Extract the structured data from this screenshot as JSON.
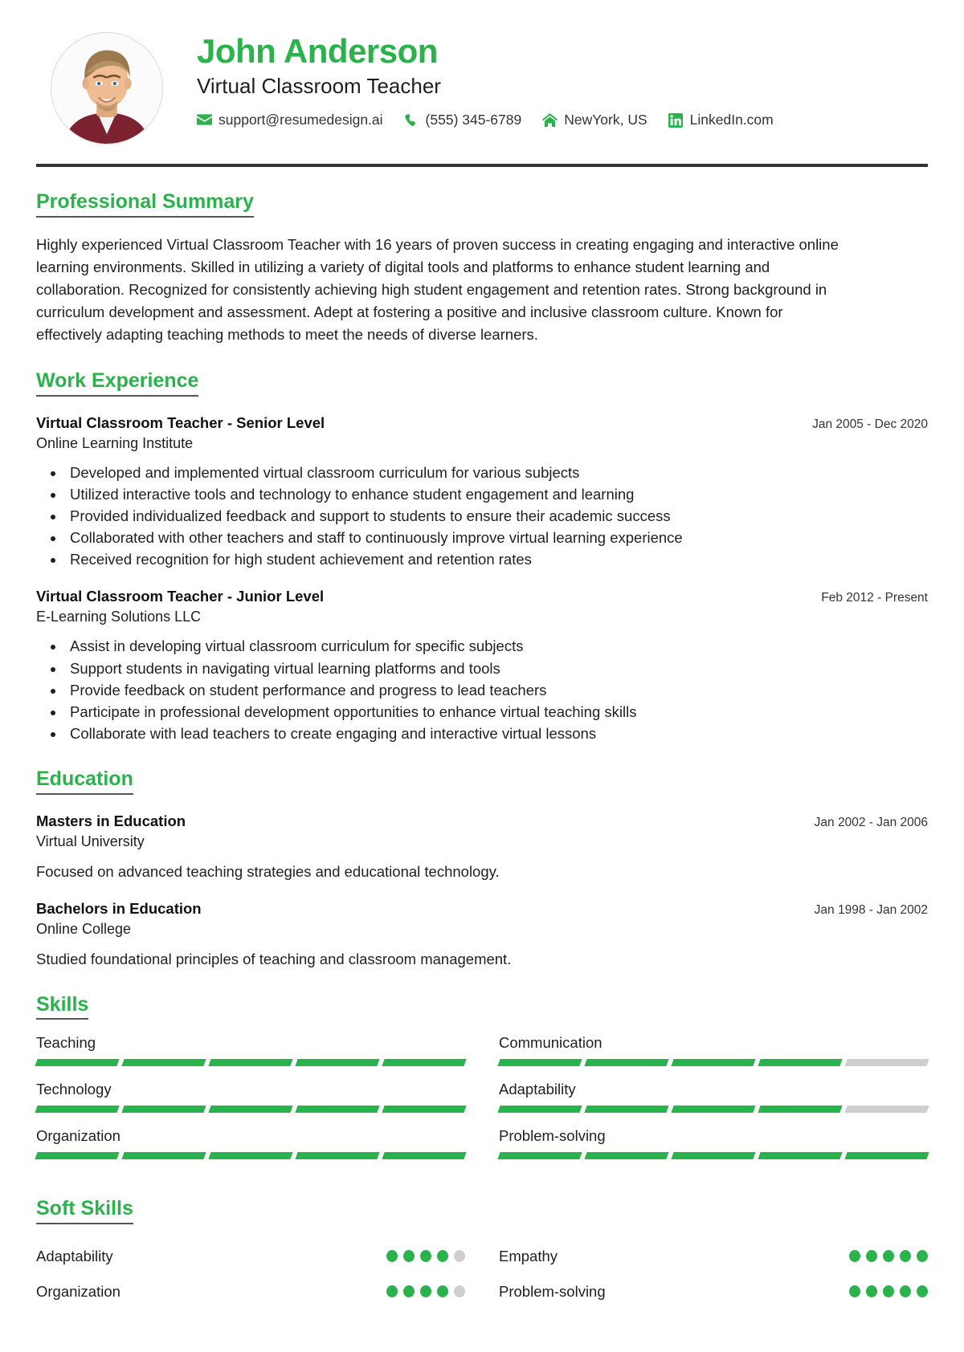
{
  "header": {
    "name": "John Anderson",
    "job_title": "Virtual Classroom Teacher",
    "avatar_alt": "profile-photo",
    "contacts": [
      {
        "icon": "email-icon",
        "text": "support@resumedesign.ai"
      },
      {
        "icon": "phone-icon",
        "text": "(555) 345-6789"
      },
      {
        "icon": "home-icon",
        "text": "NewYork, US"
      },
      {
        "icon": "linkedin-icon",
        "text": "LinkedIn.com"
      }
    ]
  },
  "summary": {
    "title": "Professional Summary",
    "text": "Highly experienced Virtual Classroom Teacher with 16 years of proven success in creating engaging and interactive online learning environments. Skilled in utilizing a variety of digital tools and platforms to enhance student learning and collaboration. Recognized for consistently achieving high student engagement and retention rates. Strong background in curriculum development and assessment. Adept at fostering a positive and inclusive classroom culture. Known for effectively adapting teaching methods to meet the needs of diverse learners."
  },
  "work_experience": {
    "title": "Work Experience",
    "entries": [
      {
        "title": "Virtual Classroom Teacher - Senior Level",
        "organization": "Online Learning Institute",
        "date": "Jan 2005 - Dec 2020",
        "bullets": [
          "Developed and implemented virtual classroom curriculum for various subjects",
          "Utilized interactive tools and technology to enhance student engagement and learning",
          "Provided individualized feedback and support to students to ensure their academic success",
          "Collaborated with other teachers and staff to continuously improve virtual learning experience",
          "Received recognition for high student achievement and retention rates"
        ]
      },
      {
        "title": "Virtual Classroom Teacher - Junior Level",
        "organization": "E-Learning Solutions LLC",
        "date": "Feb 2012 - Present",
        "bullets": [
          "Assist in developing virtual classroom curriculum for specific subjects",
          "Support students in navigating virtual learning platforms and tools",
          "Provide feedback on student performance and progress to lead teachers",
          "Participate in professional development opportunities to enhance virtual teaching skills",
          "Collaborate with lead teachers to create engaging and interactive virtual lessons"
        ]
      }
    ]
  },
  "education": {
    "title": "Education",
    "entries": [
      {
        "degree": "Masters in Education",
        "school": "Virtual University",
        "date": "Jan 2002 - Jan 2006",
        "description": "Focused on advanced teaching strategies and educational technology."
      },
      {
        "degree": "Bachelors in Education",
        "school": "Online College",
        "date": "Jan 1998 - Jan 2002",
        "description": "Studied foundational principles of teaching and classroom management."
      }
    ]
  },
  "skills": {
    "title": "Skills",
    "max": 5,
    "items": [
      {
        "label": "Teaching",
        "level": 5
      },
      {
        "label": "Communication",
        "level": 4
      },
      {
        "label": "Technology",
        "level": 5
      },
      {
        "label": "Adaptability",
        "level": 4
      },
      {
        "label": "Organization",
        "level": 5
      },
      {
        "label": "Problem-solving",
        "level": 5
      }
    ]
  },
  "soft_skills": {
    "title": "Soft Skills",
    "max": 5,
    "items": [
      {
        "label": "Adaptability",
        "level": 4
      },
      {
        "label": "Empathy",
        "level": 5
      },
      {
        "label": "Organization",
        "level": 4
      },
      {
        "label": "Problem-solving",
        "level": 5
      }
    ]
  },
  "colors": {
    "accent": "#2bb24c",
    "text": "#1f1f1f",
    "rule": "#333333",
    "muted": "#cfcfcf"
  }
}
